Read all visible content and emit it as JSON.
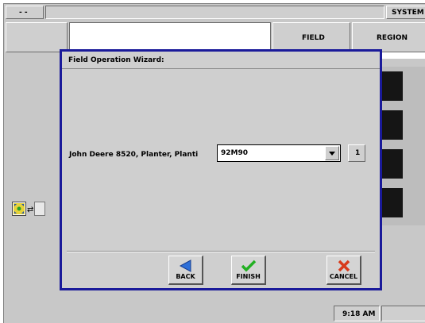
{
  "topbar": {
    "left_button": "- -",
    "right_label": "SYSTEM"
  },
  "header_tabs": {
    "field": "FIELD",
    "region": "REGION"
  },
  "dialog": {
    "title": "Field Operation Wizard:",
    "row_label": "John Deere 8520, Planter, Planti",
    "dropdown_value": "92M90",
    "count_button": "1",
    "buttons": {
      "back": "BACK",
      "finish": "FINISH",
      "cancel": "CANCEL"
    },
    "icons": {
      "back": "back-arrow-icon",
      "finish": "checkmark-icon",
      "cancel": "x-cancel-icon",
      "dropdown": "chevron-down-icon"
    },
    "colors": {
      "border": "#1a1a9a",
      "back_arrow": "#2e6fd8",
      "finish_check": "#22b022",
      "cancel_x": "#d83a1a"
    }
  },
  "status_bar": {
    "clock": "9:18 AM"
  }
}
